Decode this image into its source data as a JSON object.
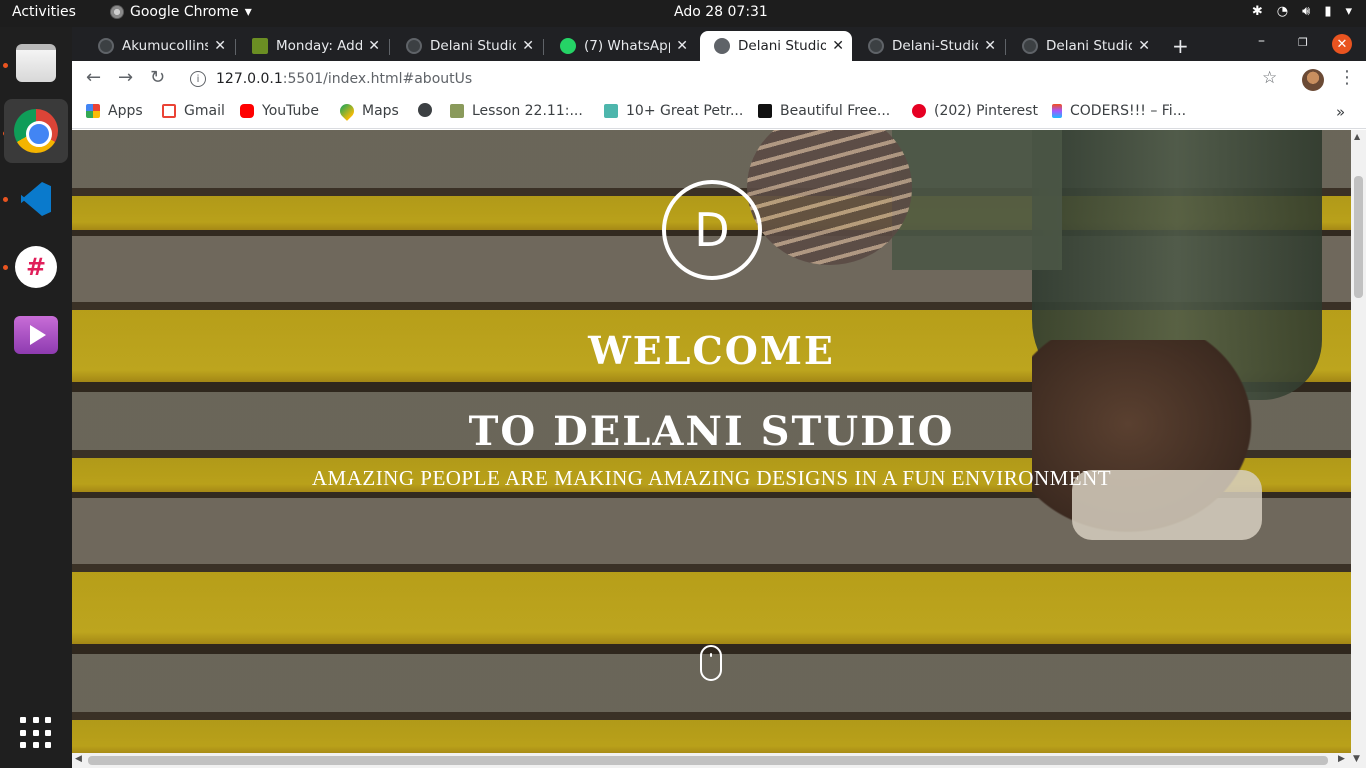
{
  "system": {
    "activities": "Activities",
    "app_name": "Google Chrome",
    "clock": "Ado 28  07:31"
  },
  "tabs": [
    {
      "label": "Akumucollins",
      "favicon": "github-icon",
      "active": false
    },
    {
      "label": "Monday: Add",
      "favicon": "tree-icon",
      "active": false
    },
    {
      "label": "Delani Studio",
      "favicon": "globe-icon",
      "active": false
    },
    {
      "label": "(7) WhatsApp",
      "favicon": "whatsapp-icon",
      "active": false
    },
    {
      "label": "Delani Studio",
      "favicon": "globe-icon",
      "active": true
    },
    {
      "label": "Delani-Studio",
      "favicon": "github-icon",
      "active": false
    },
    {
      "label": "Delani Studio",
      "favicon": "globe-icon",
      "active": false
    }
  ],
  "address": {
    "host": "127.0.0.1",
    "path": ":5501/index.html#aboutUs"
  },
  "bookmarks": [
    {
      "label": "Apps",
      "icon": "apps-grid-icon",
      "color": "#ea4335"
    },
    {
      "label": "Gmail",
      "icon": "gmail-icon",
      "color": "#ea4335"
    },
    {
      "label": "YouTube",
      "icon": "youtube-icon",
      "color": "#ff0000"
    },
    {
      "label": "Maps",
      "icon": "maps-icon",
      "color": "#34a853"
    },
    {
      "label": "",
      "icon": "globe-icon",
      "color": "#3c4043"
    },
    {
      "label": "Lesson 22.11:...",
      "icon": "tree-icon",
      "color": "#8a9a5b"
    },
    {
      "label": "10+ Great Petr...",
      "icon": "d-icon",
      "color": "#4db6ac"
    },
    {
      "label": "Beautiful Free...",
      "icon": "unsplash-icon",
      "color": "#111111"
    },
    {
      "label": "(202) Pinterest",
      "icon": "pinterest-icon",
      "color": "#e60023"
    },
    {
      "label": "CODERS!!! – Fi...",
      "icon": "figma-icon",
      "color": "#f24e1e"
    }
  ],
  "hero": {
    "logo_letter": "D",
    "welcome": "WELCOME",
    "subtitle": "TO DELANI STUDIO",
    "tagline": "AMAZING PEOPLE ARE MAKING AMAZING DESIGNS IN A FUN ENVIRONMENT"
  },
  "colors": {
    "accent": "#e95420",
    "tab_bg": "#202124",
    "stripe_yellow": "#e3c91c"
  }
}
